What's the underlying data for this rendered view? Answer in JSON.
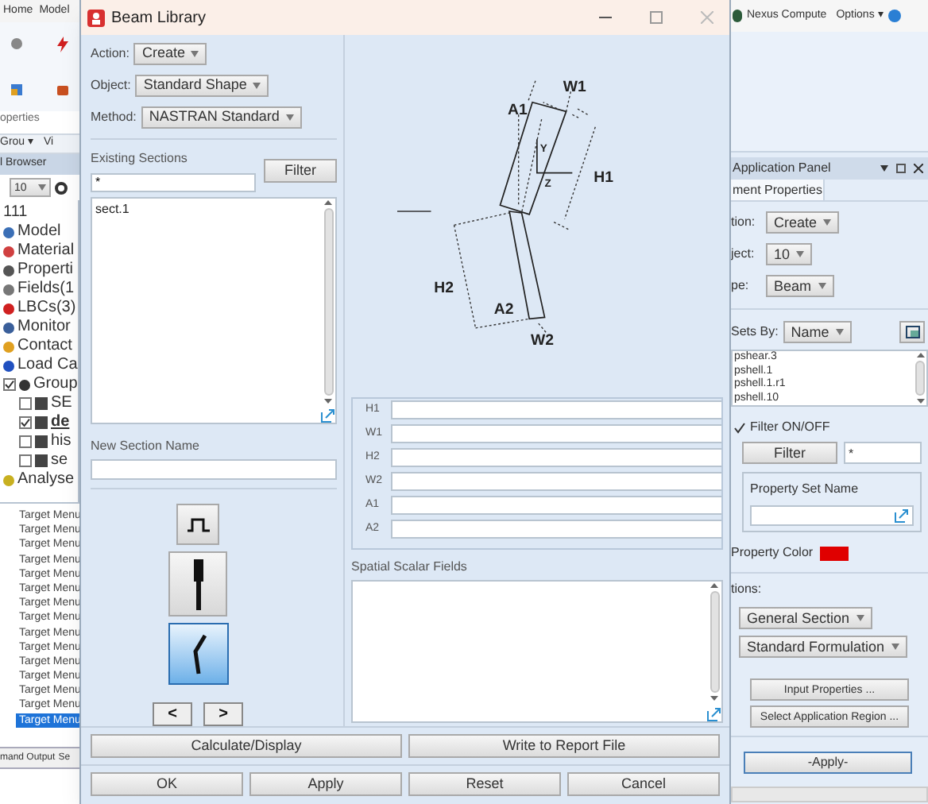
{
  "background_app": {
    "ribbon_tabs": [
      "Home",
      "Model"
    ],
    "ribbon_group_label": "operties",
    "menu_row": [
      "Grou ▾",
      "Vi"
    ],
    "browser_title": "l Browser",
    "toolbar_dropdown": "10",
    "tree": [
      {
        "label": "111",
        "kind": "root"
      },
      {
        "label": "Model",
        "kind": "model"
      },
      {
        "label": "Material",
        "kind": "material"
      },
      {
        "label": "Properti",
        "kind": "property"
      },
      {
        "label": "Fields(1",
        "kind": "field"
      },
      {
        "label": "LBCs(3)",
        "kind": "lbc"
      },
      {
        "label": "Monitor",
        "kind": "monitor"
      },
      {
        "label": "Contact",
        "kind": "contact"
      },
      {
        "label": "Load Ca",
        "kind": "load"
      },
      {
        "label": "Group",
        "kind": "group",
        "checked": true,
        "children": [
          {
            "label": "SE",
            "checked": false,
            "current": false
          },
          {
            "label": "de",
            "checked": true,
            "current": true
          },
          {
            "label": "his",
            "checked": false,
            "current": false
          },
          {
            "label": "se",
            "checked": false,
            "current": false
          }
        ]
      },
      {
        "label": "Analyse",
        "kind": "analysis"
      }
    ],
    "target_menu": [
      {
        "label": "Target Menu",
        "selected": false
      },
      {
        "label": "Target Menu",
        "selected": false
      },
      {
        "label": "Target Menu",
        "selected": false
      },
      {
        "label": "Target Menu",
        "selected": false
      },
      {
        "label": "Target Menu",
        "selected": false
      },
      {
        "label": "Target Menu",
        "selected": false
      },
      {
        "label": "Target Menu",
        "selected": false
      },
      {
        "label": "Target Menu",
        "selected": false
      },
      {
        "label": "Target Menu",
        "selected": false
      },
      {
        "label": "Target Menu",
        "selected": false
      },
      {
        "label": "Target Menu",
        "selected": false
      },
      {
        "label": "Target Menu",
        "selected": false
      },
      {
        "label": "Target Menu",
        "selected": false
      },
      {
        "label": "Target Menu",
        "selected": false
      },
      {
        "label": "Target Menu",
        "selected": true
      }
    ],
    "status_tabs": [
      "mand Output",
      "Se"
    ]
  },
  "dialog": {
    "title": "Beam Library",
    "selectors": [
      {
        "label": "Action:",
        "value": "Create"
      },
      {
        "label": "Object:",
        "value": "Standard Shape"
      },
      {
        "label": "Method:",
        "value": "NASTRAN Standard"
      }
    ],
    "existing_sections": {
      "label": "Existing Sections",
      "filter_value": "*",
      "filter_button": "Filter",
      "items": [
        {
          "label": "sect.1",
          "selected": false
        }
      ]
    },
    "new_section_name": {
      "label": "New Section Name"
    },
    "shape_buttons": [
      {
        "kind": "hat",
        "selected": false
      },
      {
        "kind": "bar",
        "selected": false
      },
      {
        "kind": "bent",
        "selected": true
      }
    ],
    "nav_buttons": [
      "<",
      ">"
    ],
    "diagram_labels": [
      "W1",
      "A1",
      "Y",
      "Z",
      "H1",
      "H2",
      "A2",
      "W2"
    ],
    "dimension_fields": [
      {
        "label": "H1"
      },
      {
        "label": "W1"
      },
      {
        "label": "H2"
      },
      {
        "label": "W2"
      },
      {
        "label": "A1"
      },
      {
        "label": "A2"
      }
    ],
    "spatial_scalar_fields": {
      "label": "Spatial Scalar Fields"
    },
    "action_buttons": [
      "Calculate/Display",
      "Write to Report File"
    ],
    "footer_buttons": [
      "OK",
      "Apply",
      "Reset",
      "Cancel"
    ]
  },
  "app_panel": {
    "top_bar": {
      "app": "Nexus Compute",
      "menu": "Options ▾"
    },
    "title": "Application Panel",
    "tab": "ment Properties",
    "rows": [
      {
        "label": "tion:",
        "value": "Create"
      },
      {
        "label": "ject:",
        "value": "10"
      },
      {
        "label": "pe:",
        "value": "Beam"
      }
    ],
    "sets_by": {
      "label": "Sets By:",
      "value": "Name"
    },
    "property_sets": [
      {
        "label": "pshear.3",
        "selected": false
      },
      {
        "label": "pshell.1",
        "selected": false
      },
      {
        "label": "pshell.1.r1",
        "selected": false
      },
      {
        "label": "pshell.10",
        "selected": false
      }
    ],
    "filter_toggle": {
      "label": "Filter ON/OFF",
      "checked": true
    },
    "filter_button": "Filter",
    "filter_value": "*",
    "property_set_name": {
      "label": "Property Set Name"
    },
    "property_color": {
      "label": "Property Color",
      "color": "#e00000"
    },
    "options_label": "tions:",
    "option_dropdowns": [
      "General Section",
      "Standard Formulation"
    ],
    "buttons": [
      "Input Properties ...",
      "Select Application Region ..."
    ],
    "apply": "-Apply-"
  }
}
